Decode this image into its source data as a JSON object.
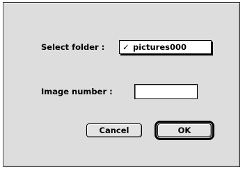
{
  "dialog": {
    "select_folder_label": "Select folder :",
    "folder_popup": {
      "checkmark": "✓",
      "selected_value": "pictures000"
    },
    "image_number_label": "Image number :",
    "image_number_value": "",
    "cancel_label": "Cancel",
    "ok_label": "OK"
  }
}
